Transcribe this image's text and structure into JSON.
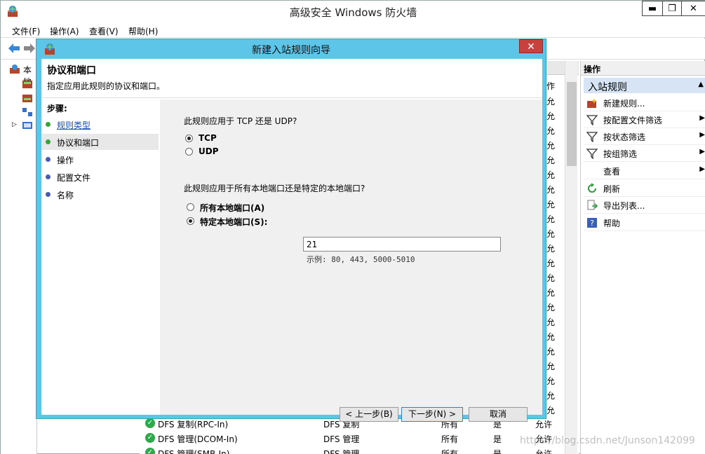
{
  "app": {
    "title": "高级安全 Windows 防火墙",
    "min": "▬",
    "max": "❐",
    "close": "✕"
  },
  "menu": [
    "文件(F)",
    "操作(A)",
    "查看(V)",
    "帮助(H)"
  ],
  "tree": {
    "root_label": "本地"
  },
  "list": {
    "header_col": "",
    "rows": [
      {
        "name": "DFS 复制(RPC-In)",
        "group": "DFS 复制",
        "profile": "所有",
        "enabled": "是",
        "action": "允许"
      },
      {
        "name": "DFS 管理(DCOM-In)",
        "group": "DFS 管理",
        "profile": "所有",
        "enabled": "是",
        "action": "允许"
      },
      {
        "name": "DFS 管理(SMB-In)",
        "group": "DFS 管理",
        "profile": "所有",
        "enabled": "是",
        "action": "允许"
      }
    ],
    "right_col_char": "允",
    "right_col_header": "作"
  },
  "actions": {
    "header": "操作",
    "section": "入站规则",
    "items": [
      {
        "label": "新建规则...",
        "icon": "new-rule-icon",
        "arrow": ""
      },
      {
        "label": "按配置文件筛选",
        "icon": "filter-icon",
        "arrow": "▶"
      },
      {
        "label": "按状态筛选",
        "icon": "filter-icon",
        "arrow": "▶"
      },
      {
        "label": "按组筛选",
        "icon": "filter-icon",
        "arrow": "▶"
      },
      {
        "label": "查看",
        "icon": "",
        "arrow": "▶"
      },
      {
        "label": "刷新",
        "icon": "refresh-icon",
        "arrow": ""
      },
      {
        "label": "导出列表...",
        "icon": "export-icon",
        "arrow": ""
      },
      {
        "label": "帮助",
        "icon": "help-icon",
        "arrow": ""
      }
    ]
  },
  "dialog": {
    "title": "新建入站规则向导",
    "close": "✕",
    "heading": "协议和端口",
    "subtitle": "指定应用此规则的协议和端口。",
    "steps_title": "步骤:",
    "steps": [
      {
        "label": "规则类型",
        "dot": "#37a33a",
        "link": true
      },
      {
        "label": "协议和端口",
        "dot": "#37a33a",
        "link": false
      },
      {
        "label": "操作",
        "dot": "#4a5bb0",
        "link": false
      },
      {
        "label": "配置文件",
        "dot": "#4a5bb0",
        "link": false
      },
      {
        "label": "名称",
        "dot": "#4a5bb0",
        "link": false
      }
    ],
    "q1": "此规则应用于 TCP 还是 UDP?",
    "tcp": "TCP",
    "udp": "UDP",
    "q2": "此规则应用于所有本地端口还是特定的本地端口?",
    "all_ports": "所有本地端口(A)",
    "specific_ports": "特定本地端口(S):",
    "port_value": "21",
    "port_example": "示例: 80, 443, 5000-5010",
    "back": "< 上一步(B)",
    "next": "下一步(N) >",
    "cancel": "取消"
  },
  "watermark": "https://blog.csdn.net/Junson142099"
}
